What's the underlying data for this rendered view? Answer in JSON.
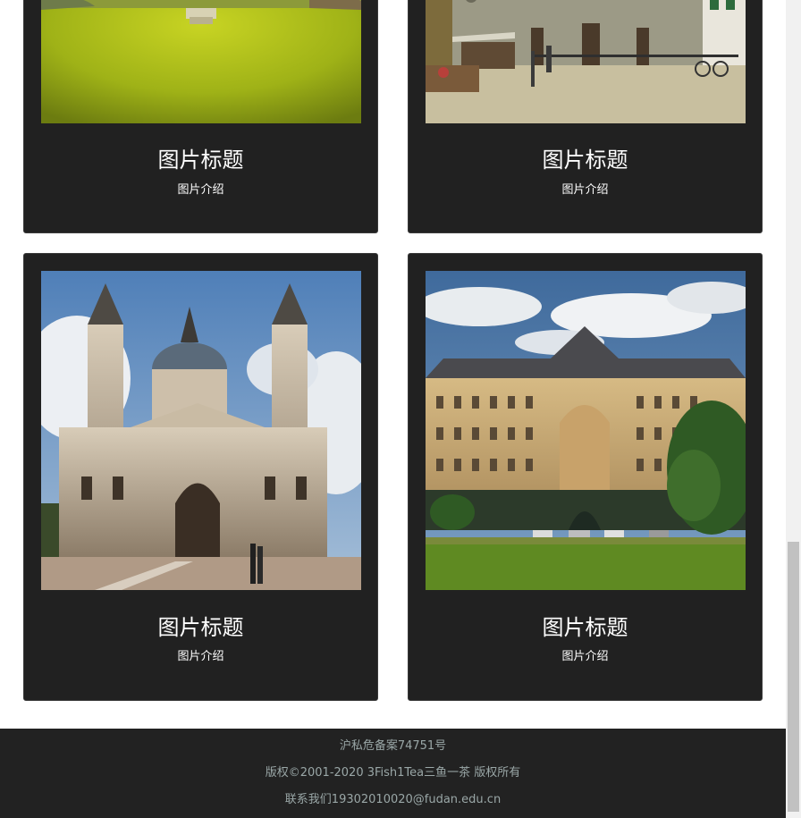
{
  "gallery": {
    "cards": [
      {
        "title": "图片标题",
        "description": "图片介绍",
        "image": "lawn-path-photo"
      },
      {
        "title": "图片标题",
        "description": "图片介绍",
        "image": "plaza-facade-photo"
      },
      {
        "title": "图片标题",
        "description": "图片介绍",
        "image": "basilica-photo"
      },
      {
        "title": "图片标题",
        "description": "图片介绍",
        "image": "palace-building-photo"
      }
    ]
  },
  "footer": {
    "icp": "沪私危备案74751号",
    "copyright": "版权©2001-2020 3Fish1Tea三鱼一茶 版权所有",
    "contact": "联系我们19302010020@fudan.edu.cn"
  },
  "colors": {
    "card_background": "#212121",
    "footer_background": "#222222",
    "footer_text": "#9aa7a7"
  }
}
